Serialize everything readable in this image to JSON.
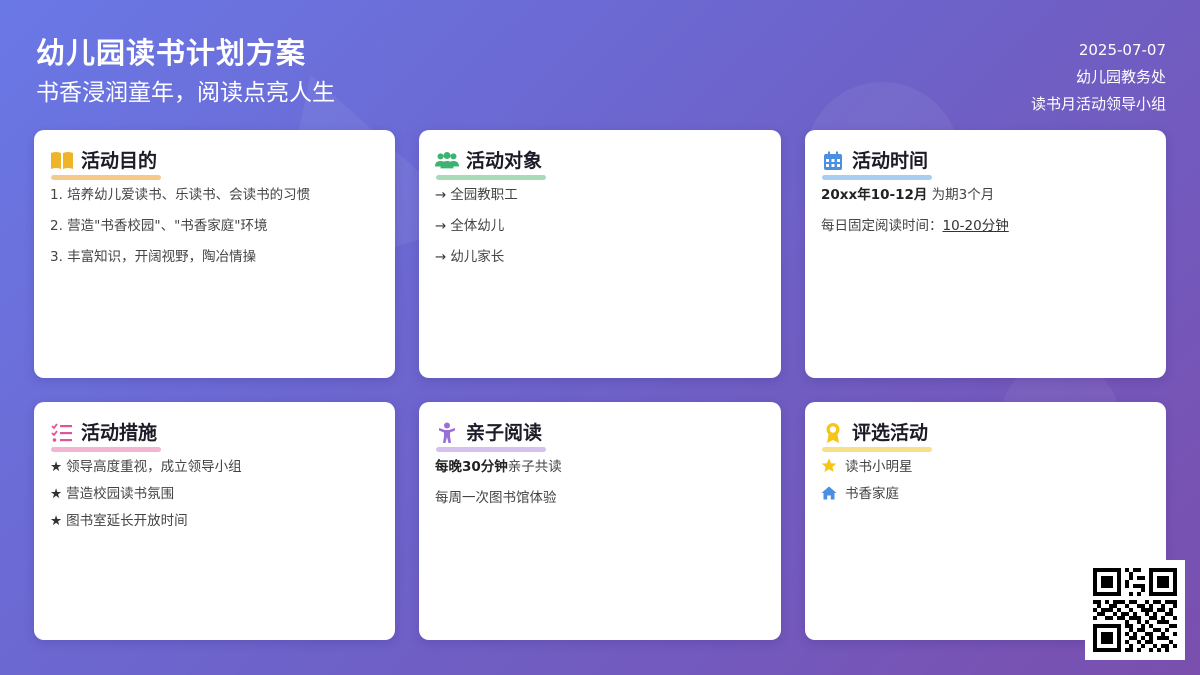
{
  "header": {
    "title": "幼儿园读书计划方案",
    "subtitle": "书香浸润童年，阅读点亮人生",
    "date": "2025-07-07",
    "org": "幼儿园教务处",
    "group": "读书月活动领导小组"
  },
  "cards": {
    "purpose": {
      "title": "活动目的",
      "items": [
        "1. 培养幼儿爱读书、乐读书、会读书的习惯",
        "2. 营造\"书香校园\"、\"书香家庭\"环境",
        "3. 丰富知识，开阔视野，陶冶情操"
      ],
      "icon": "open-book-icon",
      "color": "#f0b429"
    },
    "audience": {
      "title": "活动对象",
      "arrow": "→",
      "items": [
        "全园教职工",
        "全体幼儿",
        "幼儿家长"
      ],
      "icon": "people-group-icon",
      "color": "#3cb371"
    },
    "time": {
      "title": "活动时间",
      "period_bold": "20xx年10-12月",
      "period_rest": " 为期3个月",
      "daily_label": "每日固定阅读时间：",
      "daily_value": "10-20分钟",
      "icon": "calendar-icon",
      "color": "#4a8fe0"
    },
    "measures": {
      "title": "活动措施",
      "star": "★",
      "items": [
        "领导高度重视，成立领导小组",
        "营造校园读书氛围",
        "图书室延长开放时间"
      ],
      "icon": "checklist-icon",
      "color": "#e0559a"
    },
    "parent_child": {
      "title": "亲子阅读",
      "line1_bold": "每晚30分钟",
      "line1_rest": "亲子共读",
      "line2": "每周一次图书馆体验",
      "icon": "child-icon",
      "color": "#9b6fd8"
    },
    "selection": {
      "title": "评选活动",
      "items": [
        "读书小明星",
        "书香家庭"
      ],
      "icon": "award-icon",
      "color": "#f5c518"
    }
  }
}
